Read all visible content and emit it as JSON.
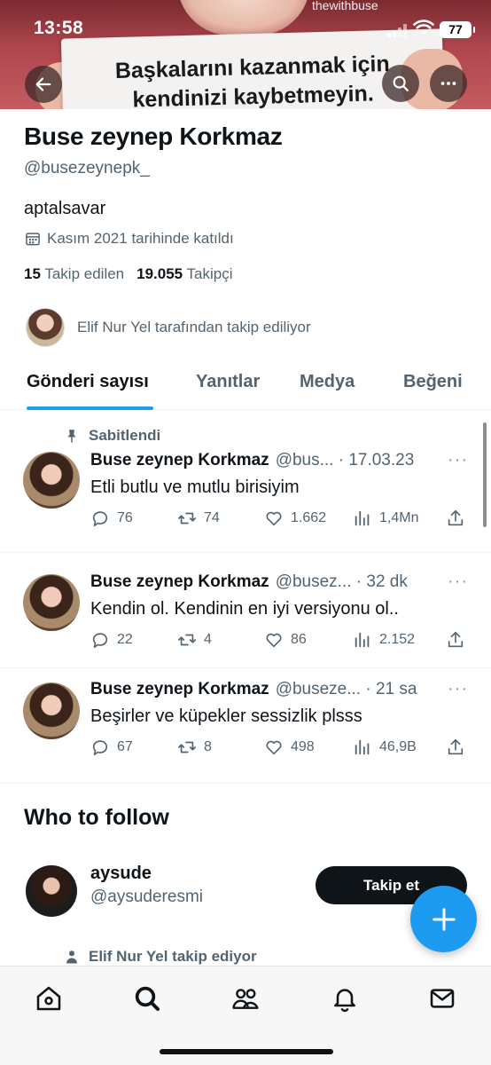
{
  "status_bar": {
    "time": "13:58",
    "battery": "77"
  },
  "banner": {
    "brand": "thewithbuse",
    "sign_text": "Başkalarını kazanmak için\nkendinizi kaybetmeyin."
  },
  "profile": {
    "display_name": "Buse zeynep Korkmaz",
    "handle": "@busezeynepk_",
    "bio": "aptalsavar",
    "joined": "Kasım 2021 tarihinde katıldı",
    "following_count": "15",
    "following_label": "Takip edilen",
    "followers_count": "19.055",
    "followers_label": "Takipçi",
    "followed_by": "Elif Nur Yel tarafından takip ediliyor"
  },
  "tabs": [
    {
      "label": "Gönderi sayısı",
      "active": true
    },
    {
      "label": "Yanıtlar",
      "active": false
    },
    {
      "label": "Medya",
      "active": false
    },
    {
      "label": "Beğeni",
      "active": false
    }
  ],
  "pinned_label": "Sabitlendi",
  "tweets": [
    {
      "name": "Buse zeynep Korkmaz",
      "meta": "@bus... · 17.03.23",
      "text": "Etli butlu ve mutlu birisiyim",
      "replies": "76",
      "retweets": "74",
      "likes": "1.662",
      "views": "1,4Mn"
    },
    {
      "name": "Buse zeynep Korkmaz",
      "meta": "@busez... · 32 dk",
      "text": "Kendin ol. Kendinin en iyi versiyonu ol..",
      "replies": "22",
      "retweets": "4",
      "likes": "86",
      "views": "2.152"
    },
    {
      "name": "Buse zeynep Korkmaz",
      "meta": "@buseze... · 21 sa",
      "text": "Beşirler ve küpekler sessizlik plsss",
      "replies": "67",
      "retweets": "8",
      "likes": "498",
      "views": "46,9B"
    }
  ],
  "who_to_follow": {
    "title": "Who to follow",
    "user": {
      "name": "aysude",
      "handle": "@aysuderesmi"
    },
    "follow_button": "Takip et",
    "social_context": "Elif Nur Yel takip ediyor"
  },
  "colors": {
    "accent": "#1d9bf0",
    "text": "#0f1419",
    "secondary": "#536471"
  }
}
